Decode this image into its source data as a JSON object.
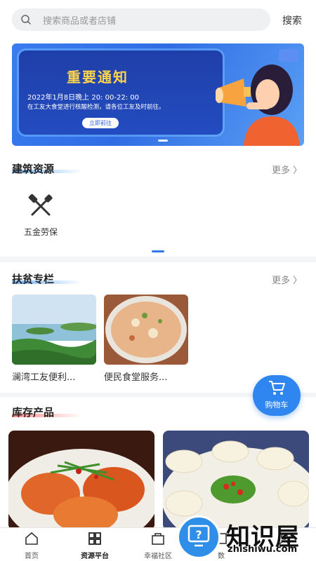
{
  "search": {
    "placeholder": "搜索商品或者店铺",
    "button": "搜索"
  },
  "banner": {
    "title": "重要通知",
    "line1": "2022年1月8日晚上 20: 00-22: 00",
    "line2": "在工友大食堂进行核酸检测，请各位工友及时前往。",
    "cta": "立即前往",
    "colors": {
      "background": "#2f6de4",
      "title": "#ffd34a"
    }
  },
  "sections": {
    "jianzhu": {
      "title": "建筑资源",
      "more": "更多",
      "items": [
        {
          "label": "五金劳保",
          "icon": "tools-icon"
        }
      ]
    },
    "fupin": {
      "title": "扶贫专栏",
      "more": "更多",
      "cards": [
        {
          "caption": "澜湾工友便利..."
        },
        {
          "caption": "便民食堂服务..."
        }
      ]
    },
    "kucun": {
      "title": "库存产品",
      "products": [
        {
          "image": "crab-dish"
        },
        {
          "image": "dumplings-dish"
        }
      ]
    }
  },
  "cart": {
    "label": "购物车",
    "icon": "cart-icon"
  },
  "tabbar": {
    "items": [
      {
        "label": "首页",
        "icon": "home-icon"
      },
      {
        "label": "资源平台",
        "icon": "grid-icon",
        "active": true
      },
      {
        "label": "幸福社区",
        "icon": "bag-icon"
      },
      {
        "label": "数",
        "icon": "chart-icon"
      },
      {
        "label": "",
        "icon": "user-icon"
      }
    ]
  },
  "watermark": {
    "text": "知识屋",
    "domain": "zhishiwu.com"
  },
  "colors": {
    "accent": "#2f86f0",
    "text": "#222222",
    "muted": "#888888"
  }
}
